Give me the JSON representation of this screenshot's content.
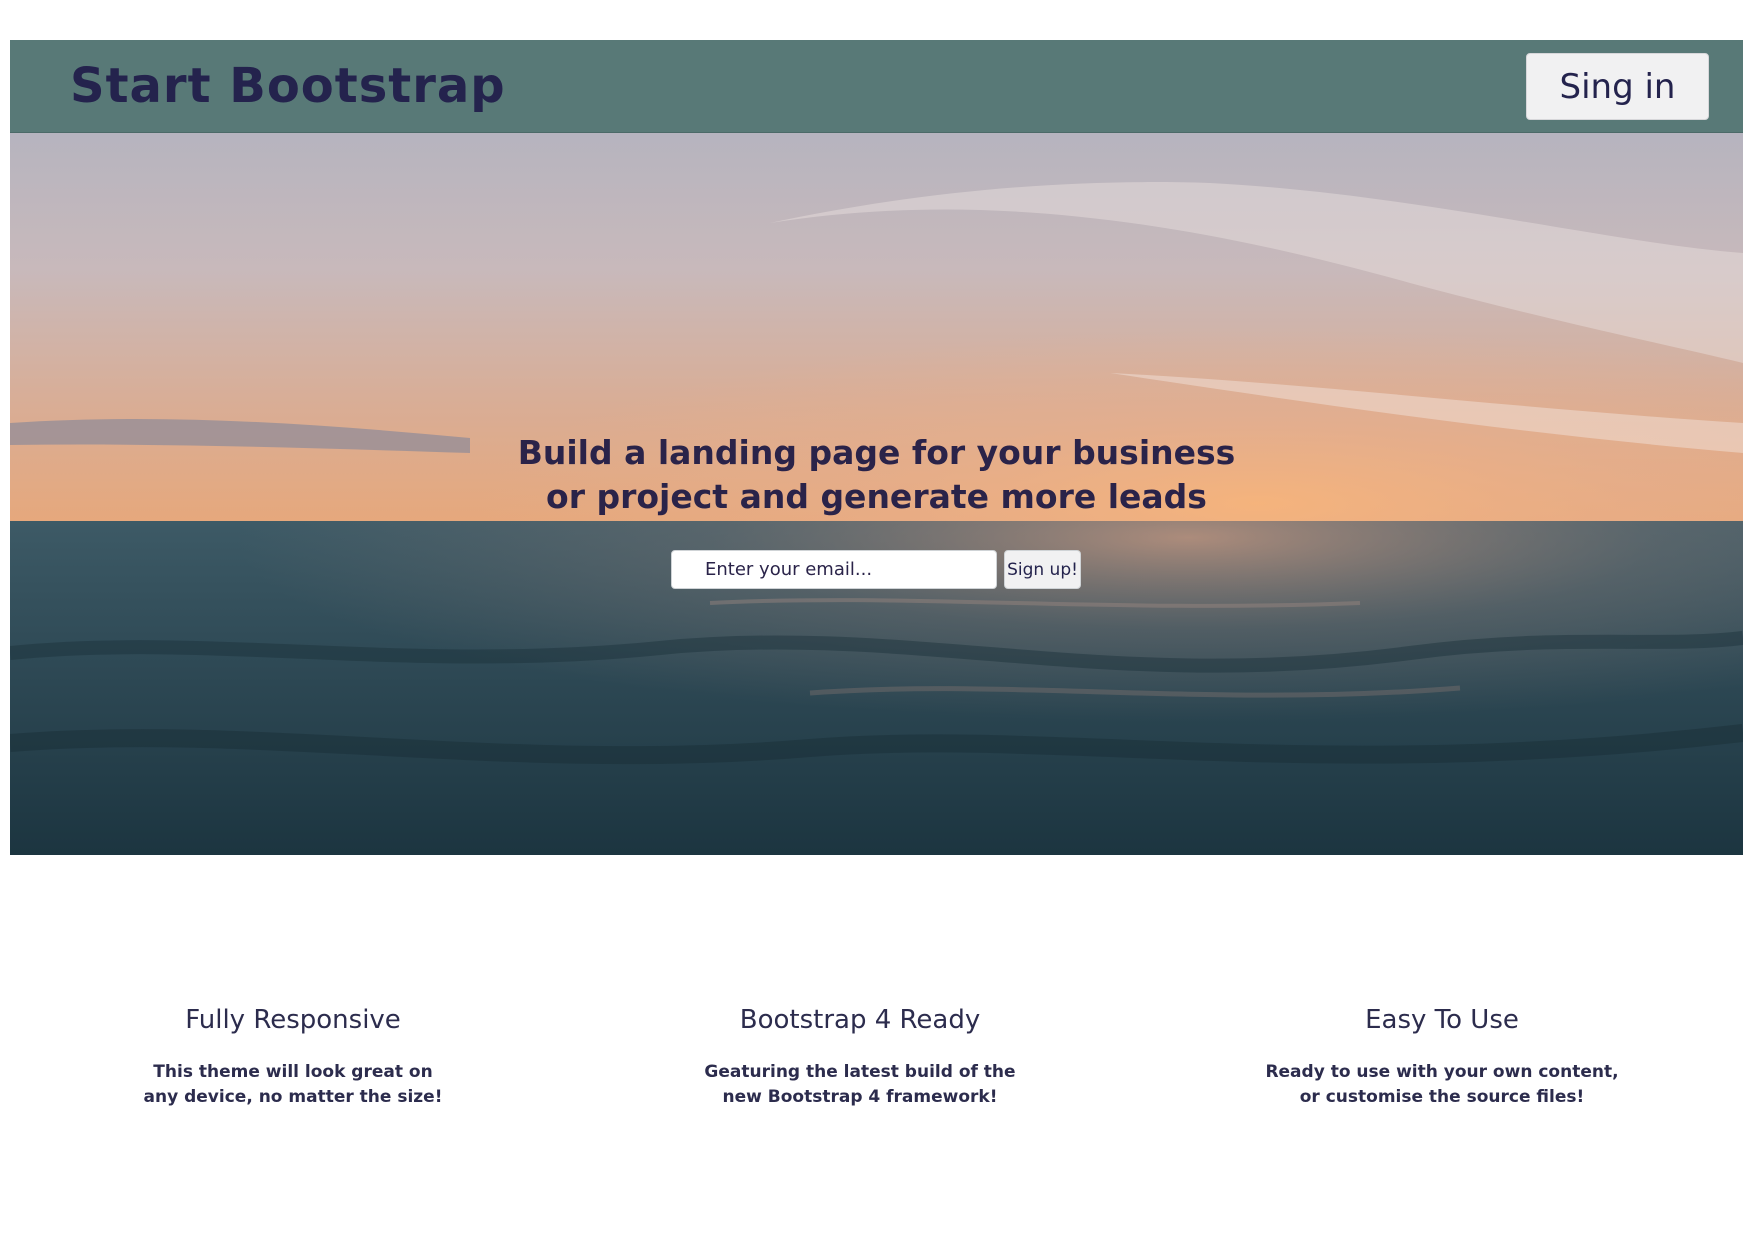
{
  "navbar": {
    "brand": "Start Bootstrap",
    "signin_label": "Sing in",
    "background_color": "#587977"
  },
  "hero": {
    "title_line1": "Build a landing page for your business",
    "title_line2": "or project and generate more leads",
    "email_placeholder": "Enter your email...",
    "signup_label": "Sign up!"
  },
  "features": [
    {
      "title": "Fully Responsive",
      "text": "This theme will look great on any device, no matter the size!"
    },
    {
      "title": "Bootstrap 4 Ready",
      "text": "Geaturing the latest build of the new Bootstrap 4 framework!"
    },
    {
      "title": "Easy To Use",
      "text": "Ready to use with your own content, or customise the source files!"
    }
  ],
  "colors": {
    "text": "#24234d",
    "button_bg": "#f1f1f2"
  }
}
